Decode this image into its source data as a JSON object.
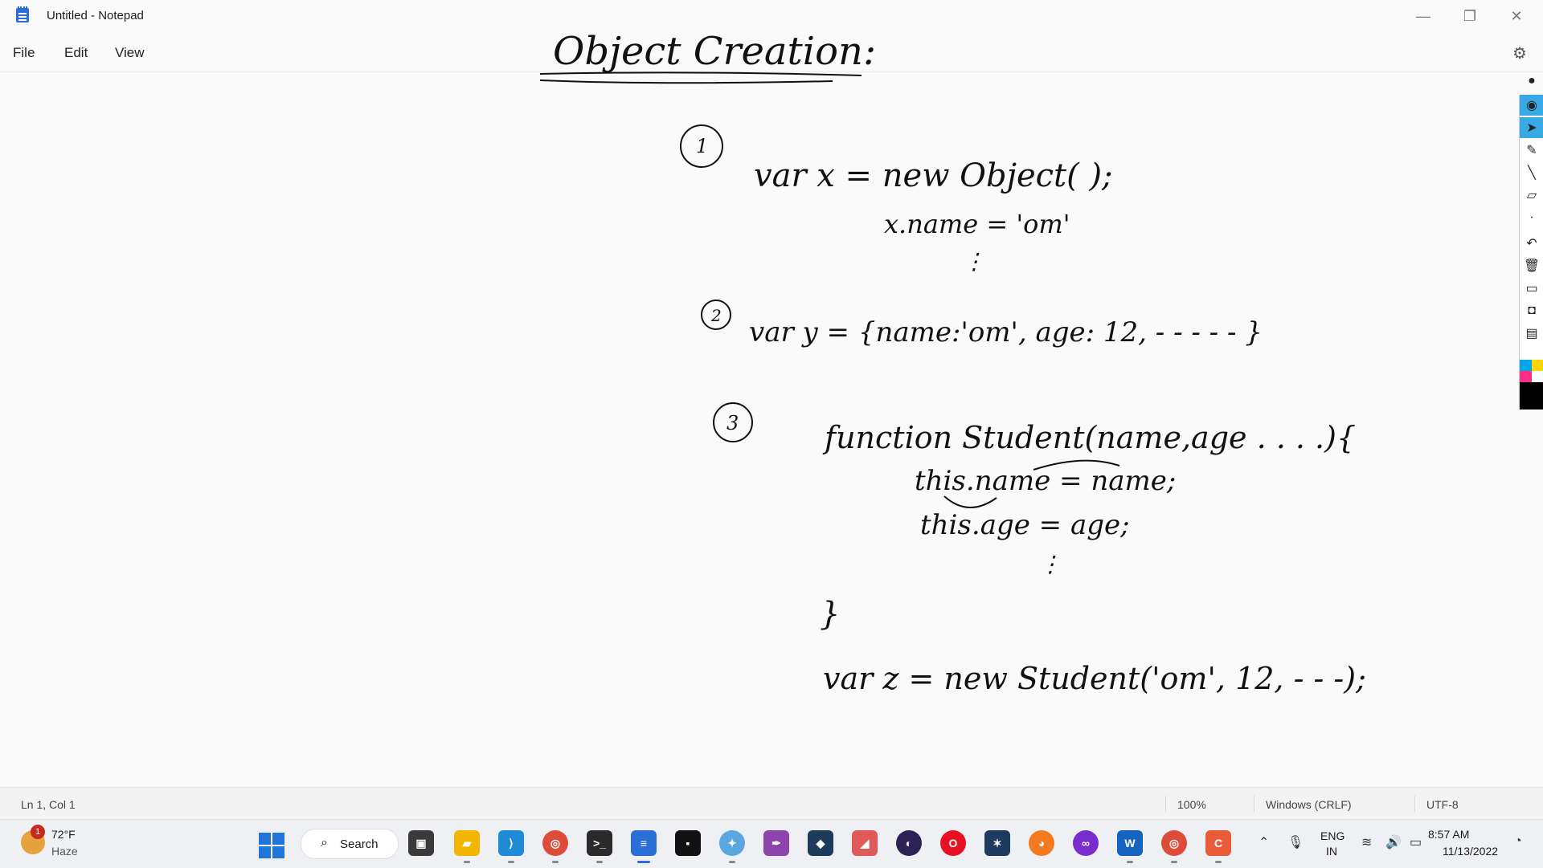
{
  "window": {
    "title": "Untitled - Notepad",
    "minimize_icon": "minimize-icon",
    "maximize_icon": "restore-icon",
    "close_icon": "close-icon"
  },
  "menu": {
    "file": "File",
    "edit": "Edit",
    "view": "View"
  },
  "settings_icon": "gear-icon",
  "handwriting": {
    "title": "Object Creation:",
    "n1": "1",
    "line1": "var   x  =  new  Object( );",
    "line1b": "x.name = 'om'",
    "ell1": "⋮",
    "n2": "2",
    "line2": "var   y   =  {name:'om', age: 12, - - - - -   }",
    "n3": "3",
    "line3": "function  Student(name,age . . . .){",
    "line3b": "this.name = name;",
    "line3c": "this.age  =  age;",
    "ell3": "⋮",
    "line3d": "}",
    "line4": "var  z  =  new  Student('om', 12, - - -);"
  },
  "annotation_toolbar": {
    "icons": [
      "lightbulb-icon",
      "eye-icon",
      "cursor-icon",
      "pen-icon",
      "line-icon",
      "eraser-icon",
      "dot-icon",
      "undo-icon",
      "trash-icon",
      "screen-icon",
      "camera-icon",
      "clipboard-icon"
    ],
    "colors": [
      "#00a8e8",
      "#ffd400",
      "#ff2d87",
      "#ffffff",
      "#000000"
    ]
  },
  "status": {
    "position": "Ln 1, Col 1",
    "zoom": "100%",
    "eol": "Windows (CRLF)",
    "encoding": "UTF-8"
  },
  "taskbar": {
    "weather": {
      "temp": "72°F",
      "condition": "Haze",
      "badge": "1"
    },
    "search_label": "Search",
    "apps": [
      "task-view",
      "file-explorer",
      "vs-code",
      "chrome",
      "terminal",
      "notepad",
      "cmd",
      "paint",
      "pen-tool",
      "mysql",
      "eraser",
      "eclipse",
      "opera",
      "app",
      "firefox",
      "app2",
      "webex",
      "chrome2",
      "app3"
    ],
    "tray": {
      "lang1": "ENG",
      "lang2": "IN",
      "time": "8:57 AM",
      "date": "11/13/2022"
    }
  }
}
